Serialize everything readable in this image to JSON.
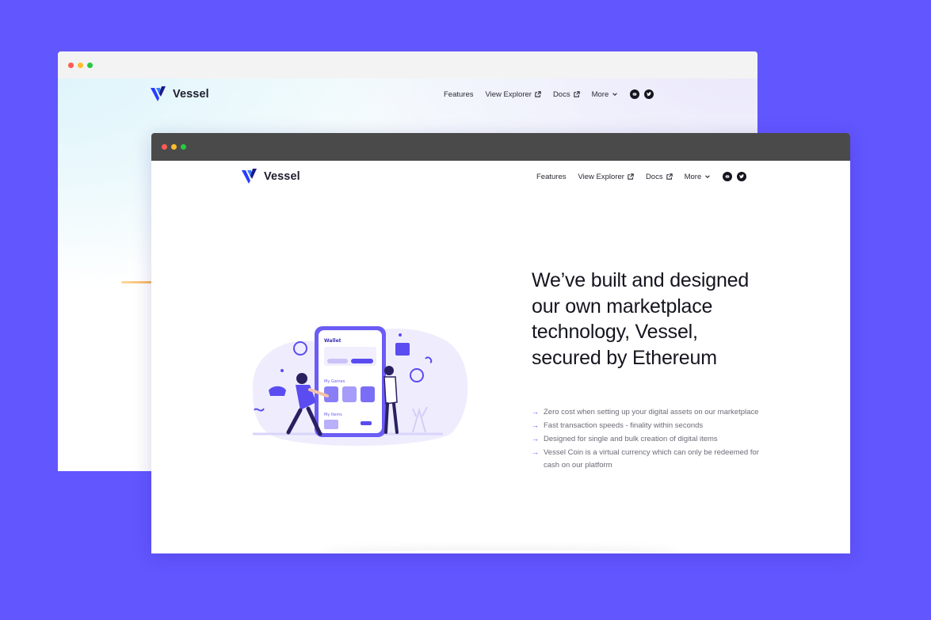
{
  "brand": {
    "name": "Vessel"
  },
  "nav": {
    "features": "Features",
    "explorer": "View Explorer",
    "docs": "Docs",
    "more": "More"
  },
  "hero": {
    "title": "We’ve built and designed our own marketplace technology, Vessel, secured by Ethereum",
    "bullets": [
      "Zero cost when setting up your digital assets on our marketplace",
      "Fast transaction speeds - finality within seconds",
      "Designed for single and bulk creation of digital items",
      "Vessel Coin is a virtual currency which can only be redeemed for cash on our platform"
    ]
  },
  "phone": {
    "wallet": "Wallet",
    "my_games": "My Games",
    "my_items": "My Items"
  },
  "icons": {
    "external": "external-link-icon",
    "chevron": "chevron-down-icon",
    "social_1": "discord-icon",
    "social_2": "twitter-icon",
    "arrow": "arrow-right-icon"
  },
  "colors": {
    "background": "#6256ff",
    "accent": "#5a4cf0",
    "front_chrome": "#4a4a4a",
    "back_chrome": "#f3f3f3"
  }
}
